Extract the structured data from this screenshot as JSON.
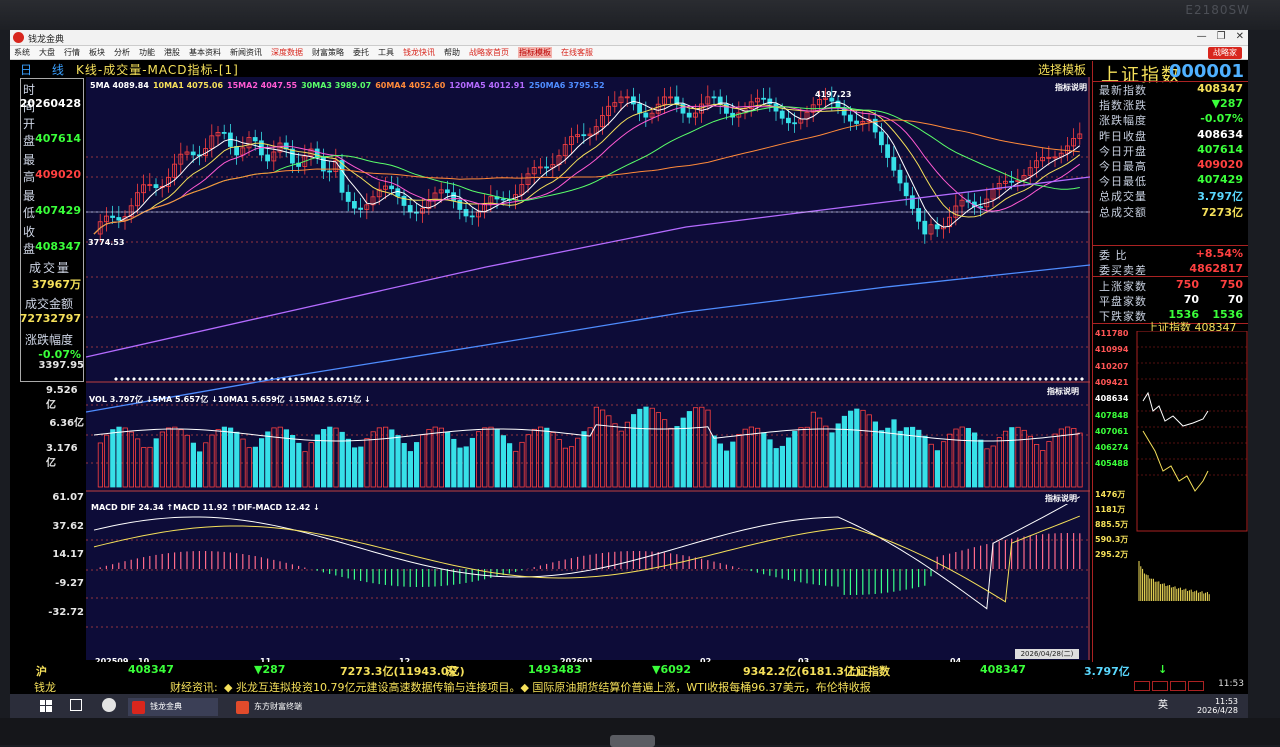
{
  "monitor": {
    "brand": "E2180SW"
  },
  "window": {
    "title": "钱龙金典",
    "controls": [
      "—",
      "❐",
      "✕"
    ]
  },
  "menu": {
    "items": [
      "系统",
      "大盘",
      "行情",
      "板块",
      "分析",
      "功能",
      "港股",
      "基本资料",
      "新闻资讯",
      "深度数据",
      "财富策略",
      "委托",
      "工具",
      "钱龙快讯",
      "帮助",
      "战略家首页",
      "指标模板",
      "在线客服"
    ],
    "special_button": "战略家"
  },
  "chart_header": {
    "period": "日 线",
    "title": "K线-成交量-MACD指标-[1]",
    "template_button": "选择模板"
  },
  "left_panel": {
    "time_label": "时 间",
    "time_value": "20260428",
    "open_label": "开 盘",
    "open_value": "407614",
    "high_label": "最 高",
    "high_value": "409020",
    "low_label": "最 低",
    "low_value": "407429",
    "close_label": "收 盘",
    "close_value": "408347",
    "volume_label": "成交量",
    "volume_value": "37967万",
    "amount_label": "成交金额",
    "amount_value": "72732797",
    "change_label": "涨跌幅度",
    "change_value": "-0.07%"
  },
  "ma_legend": [
    {
      "text": "5MA 4089.84",
      "color": "#ffffff"
    },
    {
      "text": "10MA1 4075.06",
      "color": "#f5e05a"
    },
    {
      "text": "15MA2 4047.55",
      "color": "#ff5ad2"
    },
    {
      "text": "30MA3 3989.07",
      "color": "#5aff6a"
    },
    {
      "text": "60MA4 4052.60",
      "color": "#ff8a3a"
    },
    {
      "text": "120MA5 4012.91",
      "color": "#b46bff"
    },
    {
      "text": "250MA6 3795.52",
      "color": "#4f8dff"
    }
  ],
  "price_marks": {
    "high": "4197.23",
    "low": "3774.53"
  },
  "y_ticks_volume": [
    "9.526亿",
    "6.36亿",
    "3.176亿"
  ],
  "y_ticks_macd": [
    "61.07",
    "37.62",
    "14.17",
    "-9.27",
    "-32.72"
  ],
  "y_tick_top_fragment": "3397.95",
  "vol_legend": "VOL 3.797亿 ↓5MA 5.657亿 ↓10MA1 5.659亿 ↓15MA2 5.671亿 ↓",
  "macd_legend": "MACD DIF 24.34 ↑MACD 11.92 ↑DIF-MACD 12.42 ↓",
  "indicator_button": "指标说明",
  "x_labels": [
    "202509",
    "10",
    "11",
    "12",
    "202601",
    "02",
    "03",
    "04"
  ],
  "selected_date": "2026/04/28(二)",
  "right_panel": {
    "name": "上证指数",
    "code": "000001",
    "rows": [
      {
        "k": "最新指数",
        "v": "408347",
        "color": "#f5e05a"
      },
      {
        "k": "指数涨跌",
        "v": "▼287",
        "color": "#3aff3a"
      },
      {
        "k": "涨跌幅度",
        "v": "-0.07%",
        "color": "#3aff3a"
      },
      {
        "k": "昨日收盘",
        "v": "408634",
        "color": "#ffffff"
      },
      {
        "k": "今日开盘",
        "v": "407614",
        "color": "#3aff3a"
      },
      {
        "k": "今日最高",
        "v": "409020",
        "color": "#ff4040"
      },
      {
        "k": "今日最低",
        "v": "407429",
        "color": "#3aff3a"
      },
      {
        "k": "总成交量",
        "v": "3.797亿",
        "color": "#5ad8ff"
      },
      {
        "k": "总成交额",
        "v": "7273亿",
        "color": "#f5e05a"
      }
    ],
    "rows2": [
      {
        "k": "委 比",
        "v": "+8.54%",
        "color": "#ff4040"
      },
      {
        "k": "委买卖差",
        "v": "4862817",
        "color": "#ff4040"
      }
    ],
    "rows3": [
      {
        "k": "上涨家数",
        "v1": "750",
        "v2": "750",
        "color": "#ff4040"
      },
      {
        "k": "平盘家数",
        "v1": "70",
        "v2": "70",
        "color": "#ffffff"
      },
      {
        "k": "下跌家数",
        "v1": "1536",
        "v2": "1536",
        "color": "#3aff3a"
      }
    ],
    "mini_title": "上证指数 408347",
    "mini_ticks": [
      "411780",
      "410994",
      "410207",
      "409421",
      "408634",
      "407848",
      "407061",
      "406274",
      "405488"
    ],
    "mini_vol_ticks": [
      "1476万",
      "1181万",
      "885.5万",
      "590.3万",
      "295.2万"
    ]
  },
  "ticker": {
    "sh_label": "沪",
    "sh_index": "408347",
    "sh_change": "▼287",
    "sh_amount": "7273.3亿(11943.0亿)",
    "sz_label": "深",
    "sz_index": "1493483",
    "sz_change": "▼6092",
    "sz_amount": "9342.2亿(6181.3亿)",
    "sel_name": "上证指数",
    "sel_index": "408347",
    "sel_vol": "3.797亿",
    "arrow": "↓"
  },
  "news": {
    "label": "财经资讯:",
    "text": "◆ 兆龙互连拟投资10.79亿元建设高速数据传输与连接项目。◆ 国际原油期货结算价普遍上涨，WTI收报每桶96.37美元，布伦特收报",
    "app_badge": "钱龙",
    "time": "11:53"
  },
  "taskbar": {
    "apps": [
      "钱龙金典",
      "东方财富终端"
    ],
    "tray_lang": "英",
    "tray_time": "11:53",
    "tray_date": "2026/4/28"
  },
  "colors": {
    "up": "#ff4040",
    "down": "#3aff3a",
    "cyan": "#37e0e8",
    "chart_bg": "#0d0c38"
  }
}
